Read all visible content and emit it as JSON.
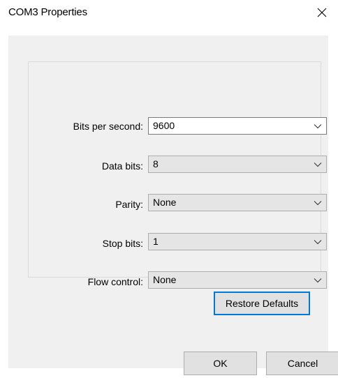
{
  "window": {
    "title": "COM3 Properties"
  },
  "fields": [
    {
      "label": "Bits per second:",
      "value": "9600",
      "editable": true
    },
    {
      "label": "Data bits:",
      "value": "8",
      "editable": false
    },
    {
      "label": "Parity:",
      "value": "None",
      "editable": false
    },
    {
      "label": "Stop bits:",
      "value": "1",
      "editable": false
    },
    {
      "label": "Flow control:",
      "value": "None",
      "editable": false
    }
  ],
  "buttons": {
    "restore_defaults": "Restore Defaults",
    "ok": "OK",
    "cancel": "Cancel"
  },
  "icons": {
    "close": "close-icon",
    "dropdown": "chevron-down-icon"
  },
  "colors": {
    "focus_border": "#0078d7",
    "dialog_background": "#f0f0f0",
    "combo_background": "#e5e5e5"
  }
}
